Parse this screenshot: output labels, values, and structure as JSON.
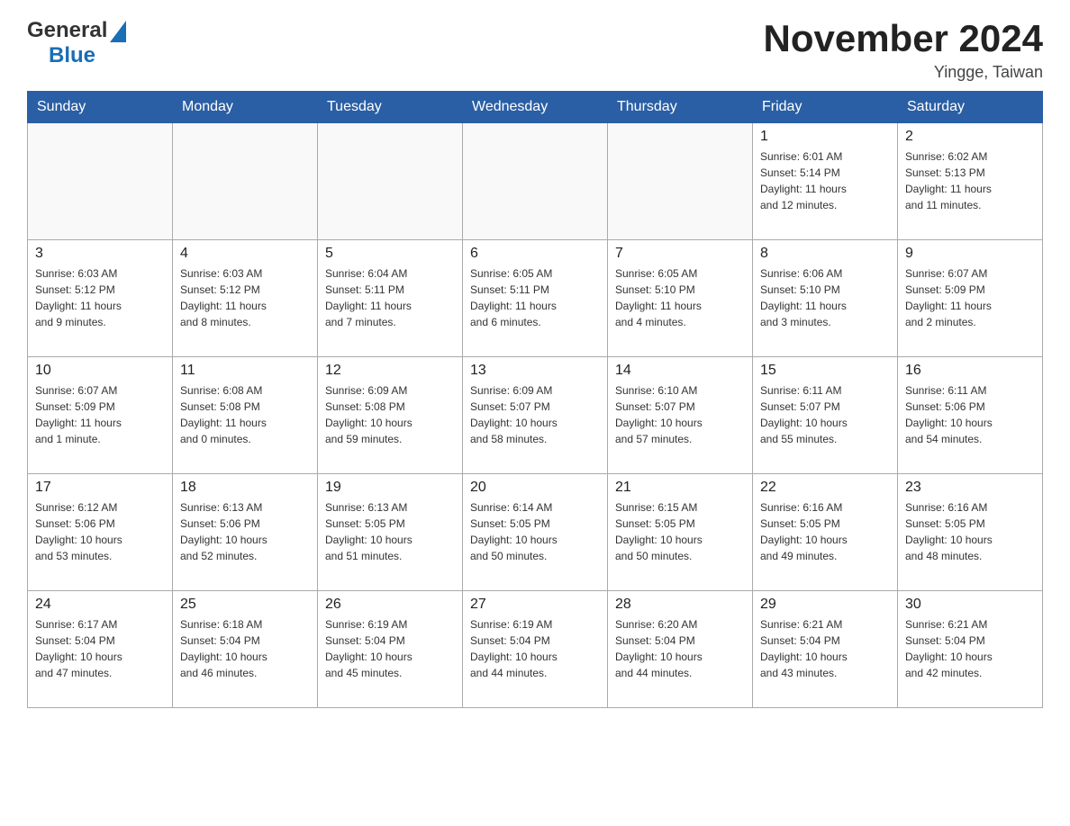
{
  "header": {
    "logo_general": "General",
    "logo_blue": "Blue",
    "title": "November 2024",
    "subtitle": "Yingge, Taiwan"
  },
  "days_of_week": [
    "Sunday",
    "Monday",
    "Tuesday",
    "Wednesday",
    "Thursday",
    "Friday",
    "Saturday"
  ],
  "weeks": [
    [
      {
        "day": "",
        "info": ""
      },
      {
        "day": "",
        "info": ""
      },
      {
        "day": "",
        "info": ""
      },
      {
        "day": "",
        "info": ""
      },
      {
        "day": "",
        "info": ""
      },
      {
        "day": "1",
        "info": "Sunrise: 6:01 AM\nSunset: 5:14 PM\nDaylight: 11 hours\nand 12 minutes."
      },
      {
        "day": "2",
        "info": "Sunrise: 6:02 AM\nSunset: 5:13 PM\nDaylight: 11 hours\nand 11 minutes."
      }
    ],
    [
      {
        "day": "3",
        "info": "Sunrise: 6:03 AM\nSunset: 5:12 PM\nDaylight: 11 hours\nand 9 minutes."
      },
      {
        "day": "4",
        "info": "Sunrise: 6:03 AM\nSunset: 5:12 PM\nDaylight: 11 hours\nand 8 minutes."
      },
      {
        "day": "5",
        "info": "Sunrise: 6:04 AM\nSunset: 5:11 PM\nDaylight: 11 hours\nand 7 minutes."
      },
      {
        "day": "6",
        "info": "Sunrise: 6:05 AM\nSunset: 5:11 PM\nDaylight: 11 hours\nand 6 minutes."
      },
      {
        "day": "7",
        "info": "Sunrise: 6:05 AM\nSunset: 5:10 PM\nDaylight: 11 hours\nand 4 minutes."
      },
      {
        "day": "8",
        "info": "Sunrise: 6:06 AM\nSunset: 5:10 PM\nDaylight: 11 hours\nand 3 minutes."
      },
      {
        "day": "9",
        "info": "Sunrise: 6:07 AM\nSunset: 5:09 PM\nDaylight: 11 hours\nand 2 minutes."
      }
    ],
    [
      {
        "day": "10",
        "info": "Sunrise: 6:07 AM\nSunset: 5:09 PM\nDaylight: 11 hours\nand 1 minute."
      },
      {
        "day": "11",
        "info": "Sunrise: 6:08 AM\nSunset: 5:08 PM\nDaylight: 11 hours\nand 0 minutes."
      },
      {
        "day": "12",
        "info": "Sunrise: 6:09 AM\nSunset: 5:08 PM\nDaylight: 10 hours\nand 59 minutes."
      },
      {
        "day": "13",
        "info": "Sunrise: 6:09 AM\nSunset: 5:07 PM\nDaylight: 10 hours\nand 58 minutes."
      },
      {
        "day": "14",
        "info": "Sunrise: 6:10 AM\nSunset: 5:07 PM\nDaylight: 10 hours\nand 57 minutes."
      },
      {
        "day": "15",
        "info": "Sunrise: 6:11 AM\nSunset: 5:07 PM\nDaylight: 10 hours\nand 55 minutes."
      },
      {
        "day": "16",
        "info": "Sunrise: 6:11 AM\nSunset: 5:06 PM\nDaylight: 10 hours\nand 54 minutes."
      }
    ],
    [
      {
        "day": "17",
        "info": "Sunrise: 6:12 AM\nSunset: 5:06 PM\nDaylight: 10 hours\nand 53 minutes."
      },
      {
        "day": "18",
        "info": "Sunrise: 6:13 AM\nSunset: 5:06 PM\nDaylight: 10 hours\nand 52 minutes."
      },
      {
        "day": "19",
        "info": "Sunrise: 6:13 AM\nSunset: 5:05 PM\nDaylight: 10 hours\nand 51 minutes."
      },
      {
        "day": "20",
        "info": "Sunrise: 6:14 AM\nSunset: 5:05 PM\nDaylight: 10 hours\nand 50 minutes."
      },
      {
        "day": "21",
        "info": "Sunrise: 6:15 AM\nSunset: 5:05 PM\nDaylight: 10 hours\nand 50 minutes."
      },
      {
        "day": "22",
        "info": "Sunrise: 6:16 AM\nSunset: 5:05 PM\nDaylight: 10 hours\nand 49 minutes."
      },
      {
        "day": "23",
        "info": "Sunrise: 6:16 AM\nSunset: 5:05 PM\nDaylight: 10 hours\nand 48 minutes."
      }
    ],
    [
      {
        "day": "24",
        "info": "Sunrise: 6:17 AM\nSunset: 5:04 PM\nDaylight: 10 hours\nand 47 minutes."
      },
      {
        "day": "25",
        "info": "Sunrise: 6:18 AM\nSunset: 5:04 PM\nDaylight: 10 hours\nand 46 minutes."
      },
      {
        "day": "26",
        "info": "Sunrise: 6:19 AM\nSunset: 5:04 PM\nDaylight: 10 hours\nand 45 minutes."
      },
      {
        "day": "27",
        "info": "Sunrise: 6:19 AM\nSunset: 5:04 PM\nDaylight: 10 hours\nand 44 minutes."
      },
      {
        "day": "28",
        "info": "Sunrise: 6:20 AM\nSunset: 5:04 PM\nDaylight: 10 hours\nand 44 minutes."
      },
      {
        "day": "29",
        "info": "Sunrise: 6:21 AM\nSunset: 5:04 PM\nDaylight: 10 hours\nand 43 minutes."
      },
      {
        "day": "30",
        "info": "Sunrise: 6:21 AM\nSunset: 5:04 PM\nDaylight: 10 hours\nand 42 minutes."
      }
    ]
  ]
}
